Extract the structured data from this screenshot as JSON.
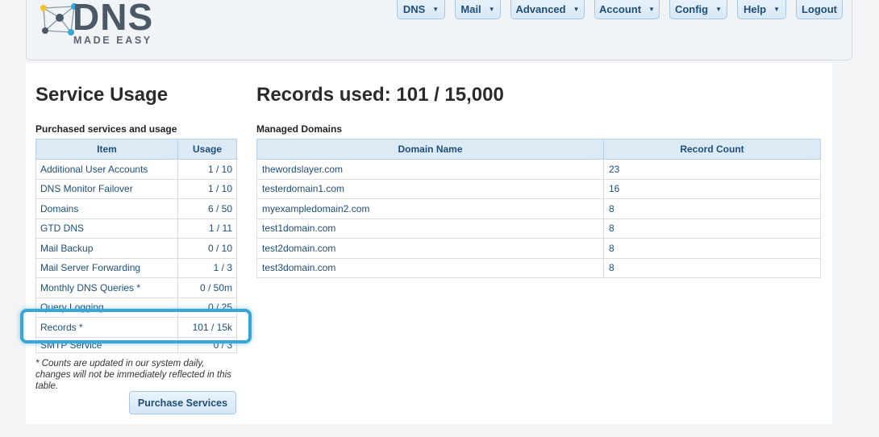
{
  "header": {
    "logo_main": "DNS",
    "logo_sub": "MADE EASY",
    "nav": [
      {
        "label": "DNS",
        "has_dropdown": true
      },
      {
        "label": "Mail",
        "has_dropdown": true
      },
      {
        "label": "Advanced",
        "has_dropdown": true
      },
      {
        "label": "Account",
        "has_dropdown": true
      },
      {
        "label": "Config",
        "has_dropdown": true
      },
      {
        "label": "Help",
        "has_dropdown": true
      },
      {
        "label": "Logout",
        "has_dropdown": false
      }
    ]
  },
  "service_usage": {
    "title": "Service Usage",
    "subtitle": "Purchased services and usage",
    "columns": [
      "Item",
      "Usage"
    ],
    "rows": [
      {
        "item": "Additional User Accounts",
        "usage": "1 / 10"
      },
      {
        "item": "DNS Monitor Failover",
        "usage": "1 / 10"
      },
      {
        "item": "Domains",
        "usage": "6 / 50"
      },
      {
        "item": "GTD DNS",
        "usage": "1 / 11"
      },
      {
        "item": "Mail Backup",
        "usage": "0 / 10"
      },
      {
        "item": "Mail Server Forwarding",
        "usage": "1 / 3"
      },
      {
        "item": "Monthly DNS Queries *",
        "usage": "0 / 50m"
      },
      {
        "item": "Query Logging",
        "usage": "0 / 25"
      },
      {
        "item": "Records *",
        "usage": "101 / 15k"
      },
      {
        "item": "SMTP Service",
        "usage": "0 / 3"
      }
    ],
    "note": "* Counts are updated in our system daily, changes will not be immediately reflected in this table.",
    "purchase_button": "Purchase Services"
  },
  "records": {
    "title": "Records used: 101 / 15,000",
    "subtitle": "Managed Domains",
    "columns": [
      "Domain Name",
      "Record Count"
    ],
    "rows": [
      {
        "domain": "thewordslayer.com",
        "count": "23"
      },
      {
        "domain": "testerdomain1.com",
        "count": "16"
      },
      {
        "domain": "myexampledomain2.com",
        "count": "8"
      },
      {
        "domain": "test1domain.com",
        "count": "8"
      },
      {
        "domain": "test2domain.com",
        "count": "8"
      },
      {
        "domain": "test3domain.com",
        "count": "8"
      }
    ]
  },
  "colors": {
    "highlight": "#3aa6d8",
    "link": "#1f4e7a",
    "header_bg": "#dceaf6"
  }
}
